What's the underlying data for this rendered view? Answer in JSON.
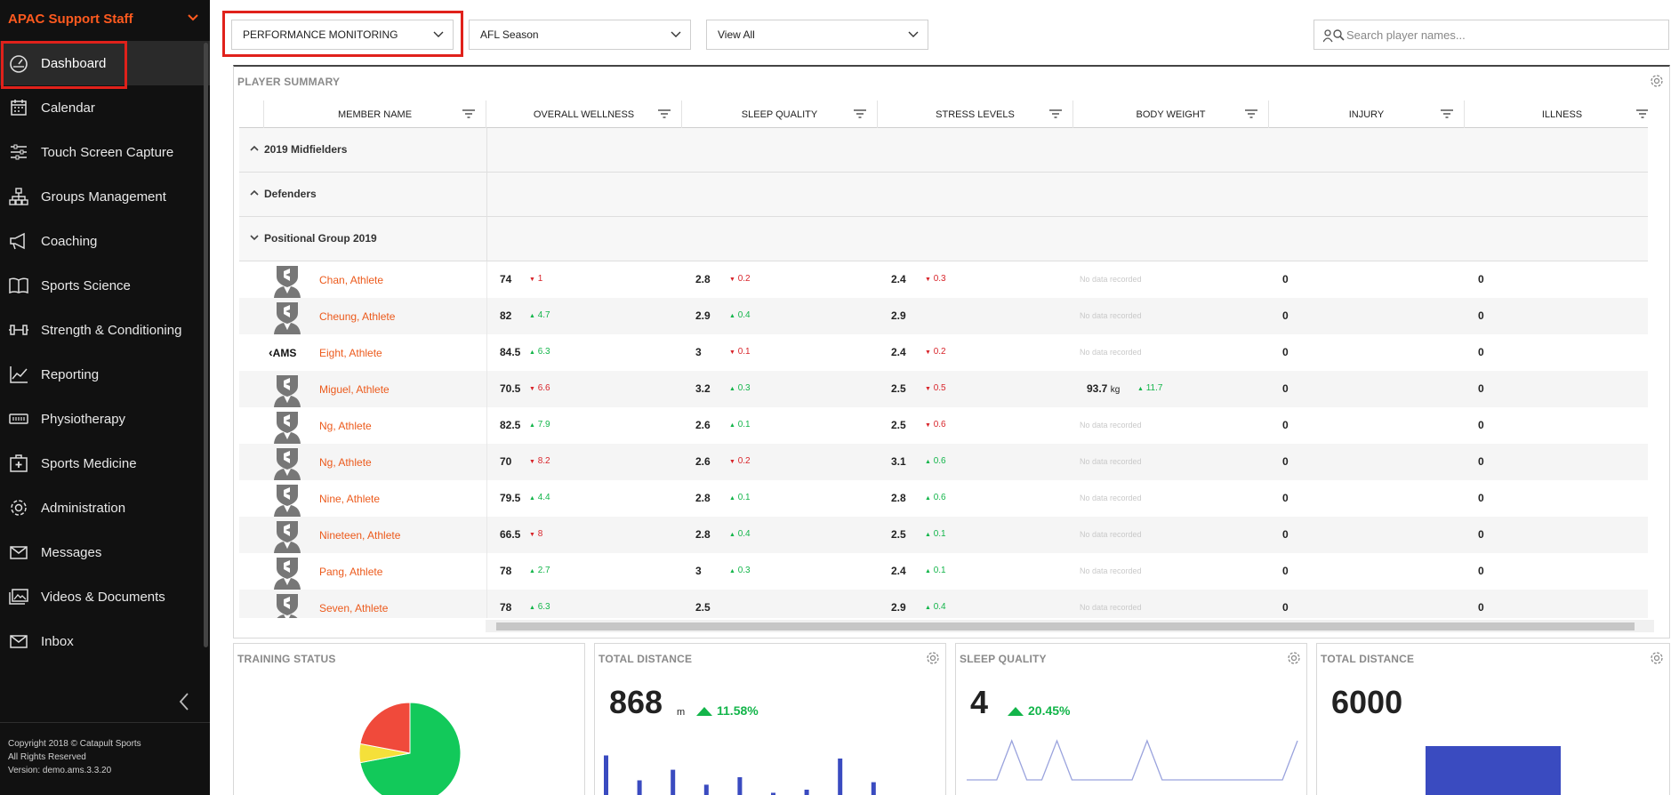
{
  "sidebar": {
    "org": "APAC Support Staff",
    "items": [
      {
        "label": "Dashboard",
        "icon": "dashboard-icon",
        "active": true
      },
      {
        "label": "Calendar",
        "icon": "calendar-icon"
      },
      {
        "label": "Touch Screen Capture",
        "icon": "sliders-icon"
      },
      {
        "label": "Groups Management",
        "icon": "hierarchy-icon"
      },
      {
        "label": "Coaching",
        "icon": "megaphone-icon"
      },
      {
        "label": "Sports Science",
        "icon": "book-icon"
      },
      {
        "label": "Strength & Conditioning",
        "icon": "dumbbell-icon"
      },
      {
        "label": "Reporting",
        "icon": "line-chart-icon"
      },
      {
        "label": "Physiotherapy",
        "icon": "physio-icon"
      },
      {
        "label": "Sports Medicine",
        "icon": "medical-kit-icon"
      },
      {
        "label": "Administration",
        "icon": "gear-icon"
      },
      {
        "label": "Messages",
        "icon": "envelope-icon"
      },
      {
        "label": "Videos & Documents",
        "icon": "images-icon"
      },
      {
        "label": "Inbox",
        "icon": "inbox-icon"
      }
    ],
    "copyright": [
      "Copyright 2018 © Catapult Sports",
      "All Rights Reserved",
      "Version: demo.ams.3.3.20"
    ]
  },
  "topbar": {
    "program": "PERFORMANCE MONITORING",
    "season": "AFL Season",
    "view": "View All",
    "search_placeholder": "Search player names..."
  },
  "summary": {
    "title": "PLAYER SUMMARY",
    "columns": [
      "MEMBER NAME",
      "OVERALL WELLNESS",
      "SLEEP QUALITY",
      "STRESS LEVELS",
      "BODY WEIGHT",
      "INJURY",
      "ILLNESS"
    ],
    "groups": [
      {
        "label": "2019 Midfielders",
        "expanded": false
      },
      {
        "label": "Defenders",
        "expanded": false
      },
      {
        "label": "Positional Group 2019",
        "expanded": true
      }
    ],
    "no_data_text": "No data recorded",
    "rows": [
      {
        "name": "Chan, Athlete",
        "avatar": "shield-avatar-icon",
        "wellness": "74",
        "wellness_chg": "1",
        "wellness_dir": "down",
        "sleep": "2.8",
        "sleep_chg": "0.2",
        "sleep_dir": "down",
        "stress": "2.4",
        "stress_chg": "0.3",
        "stress_dir": "down",
        "weight": null,
        "weight_unit": "",
        "weight_chg": "",
        "weight_dir": "",
        "injury": "0",
        "illness": "0"
      },
      {
        "name": "Cheung, Athlete",
        "avatar": "shield-avatar-icon",
        "wellness": "82",
        "wellness_chg": "4.7",
        "wellness_dir": "up",
        "sleep": "2.9",
        "sleep_chg": "0.4",
        "sleep_dir": "up",
        "stress": "2.9",
        "stress_chg": "",
        "stress_dir": "",
        "weight": null,
        "weight_unit": "",
        "weight_chg": "",
        "weight_dir": "",
        "injury": "0",
        "illness": "0"
      },
      {
        "name": "Eight, Athlete",
        "avatar": "ams-logo",
        "avatar_text": "AMS",
        "wellness": "84.5",
        "wellness_chg": "6.3",
        "wellness_dir": "up",
        "sleep": "3",
        "sleep_chg": "0.1",
        "sleep_dir": "down",
        "stress": "2.4",
        "stress_chg": "0.2",
        "stress_dir": "down",
        "weight": null,
        "weight_unit": "",
        "weight_chg": "",
        "weight_dir": "",
        "injury": "0",
        "illness": "0"
      },
      {
        "name": "Miguel, Athlete",
        "avatar": "shield-avatar-icon",
        "wellness": "70.5",
        "wellness_chg": "6.6",
        "wellness_dir": "down",
        "sleep": "3.2",
        "sleep_chg": "0.3",
        "sleep_dir": "up",
        "stress": "2.5",
        "stress_chg": "0.5",
        "stress_dir": "down",
        "weight": "93.7",
        "weight_unit": "kg",
        "weight_chg": "11.7",
        "weight_dir": "up",
        "injury": "0",
        "illness": "0"
      },
      {
        "name": "Ng, Athlete",
        "avatar": "shield-avatar-icon",
        "wellness": "82.5",
        "wellness_chg": "7.9",
        "wellness_dir": "up",
        "sleep": "2.6",
        "sleep_chg": "0.1",
        "sleep_dir": "up",
        "stress": "2.5",
        "stress_chg": "0.6",
        "stress_dir": "down",
        "weight": null,
        "weight_unit": "",
        "weight_chg": "",
        "weight_dir": "",
        "injury": "0",
        "illness": "0"
      },
      {
        "name": "Ng, Athlete",
        "avatar": "shield-avatar-icon",
        "wellness": "70",
        "wellness_chg": "8.2",
        "wellness_dir": "down",
        "sleep": "2.6",
        "sleep_chg": "0.2",
        "sleep_dir": "down",
        "stress": "3.1",
        "stress_chg": "0.6",
        "stress_dir": "up",
        "weight": null,
        "weight_unit": "",
        "weight_chg": "",
        "weight_dir": "",
        "injury": "0",
        "illness": "0"
      },
      {
        "name": "Nine, Athlete",
        "avatar": "shield-avatar-icon",
        "wellness": "79.5",
        "wellness_chg": "4.4",
        "wellness_dir": "up",
        "sleep": "2.8",
        "sleep_chg": "0.1",
        "sleep_dir": "up",
        "stress": "2.8",
        "stress_chg": "0.6",
        "stress_dir": "up",
        "weight": null,
        "weight_unit": "",
        "weight_chg": "",
        "weight_dir": "",
        "injury": "0",
        "illness": "0"
      },
      {
        "name": "Nineteen, Athlete",
        "avatar": "shield-avatar-icon",
        "wellness": "66.5",
        "wellness_chg": "8",
        "wellness_dir": "down",
        "sleep": "2.8",
        "sleep_chg": "0.4",
        "sleep_dir": "up",
        "stress": "2.5",
        "stress_chg": "0.1",
        "stress_dir": "up",
        "weight": null,
        "weight_unit": "",
        "weight_chg": "",
        "weight_dir": "",
        "injury": "0",
        "illness": "0"
      },
      {
        "name": "Pang, Athlete",
        "avatar": "shield-avatar-icon",
        "wellness": "78",
        "wellness_chg": "2.7",
        "wellness_dir": "up",
        "sleep": "3",
        "sleep_chg": "0.3",
        "sleep_dir": "up",
        "stress": "2.4",
        "stress_chg": "0.1",
        "stress_dir": "up",
        "weight": null,
        "weight_unit": "",
        "weight_chg": "",
        "weight_dir": "",
        "injury": "0",
        "illness": "0"
      },
      {
        "name": "Seven, Athlete",
        "avatar": "shield-avatar-icon",
        "wellness": "78",
        "wellness_chg": "6.3",
        "wellness_dir": "up",
        "sleep": "2.5",
        "sleep_chg": "",
        "sleep_dir": "",
        "stress": "2.9",
        "stress_chg": "0.4",
        "stress_dir": "up",
        "weight": null,
        "weight_unit": "",
        "weight_chg": "",
        "weight_dir": "",
        "injury": "0",
        "illness": "0"
      }
    ]
  },
  "widgets": {
    "training_status": {
      "title": "TRAINING STATUS",
      "chart_data": {
        "type": "pie",
        "slices": [
          {
            "value": 0.72,
            "color": "#12c95a"
          },
          {
            "value": 0.06,
            "color": "#f5e03a"
          },
          {
            "value": 0.22,
            "color": "#f04a3b"
          }
        ]
      }
    },
    "total_distance": {
      "title": "TOTAL DISTANCE",
      "value": "868",
      "unit": "m",
      "change": "11.58%",
      "change_dir": "up",
      "chart_data": {
        "type": "bar",
        "values": [
          0.85,
          0.45,
          0.62,
          0.38,
          0.5,
          0.25,
          0.3,
          0.8,
          0.42,
          0.15,
          0.12
        ]
      }
    },
    "sleep_quality": {
      "title": "SLEEP QUALITY",
      "value": "4",
      "change": "20.45%",
      "change_dir": "up",
      "chart_data": {
        "type": "line",
        "values": [
          0,
          0,
          0,
          1,
          0,
          0,
          1,
          0,
          0,
          0,
          0,
          0,
          1,
          0,
          0,
          0,
          0,
          0,
          0,
          0,
          0,
          0,
          1
        ]
      }
    },
    "total_distance_2": {
      "title": "TOTAL DISTANCE",
      "value": "6000",
      "chart_data": {
        "type": "bar",
        "values": [
          1
        ]
      }
    }
  },
  "colors": {
    "accent": "#ec5a1c",
    "up": "#13b54a",
    "down": "#d8242a",
    "highlight": "#e0211b",
    "chart_blue": "#3a4bc0"
  }
}
